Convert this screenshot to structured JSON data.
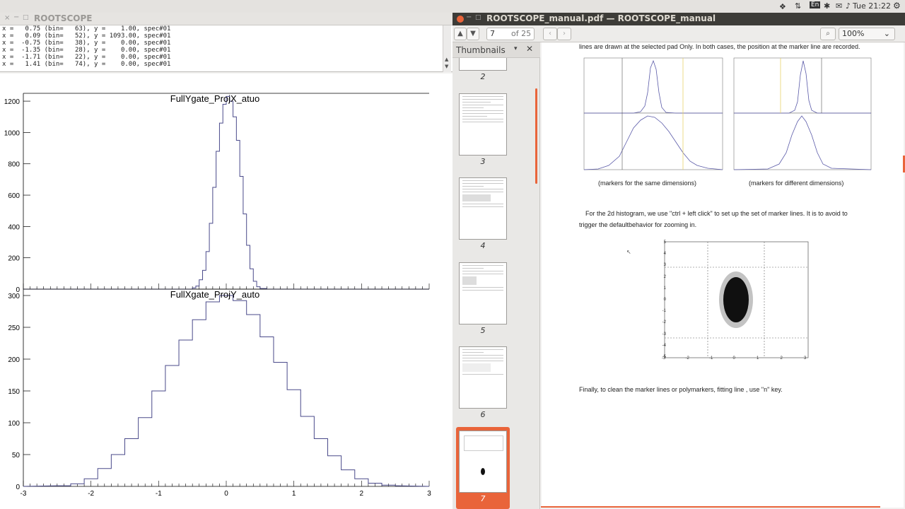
{
  "system": {
    "clock": "Tue 21:22",
    "keyboard": "En"
  },
  "root_window": {
    "title": "ROOTSCOPE",
    "console_lines": [
      "x =   0.75 (bin=   63), y =    1.00, spec#01",
      "x =   0.09 (bin=   52), y = 1093.00, spec#01",
      "x =  -0.75 (bin=   38), y =    0.00, spec#01",
      "x =  -1.35 (bin=   28), y =    0.00, spec#01",
      "x =  -1.71 (bin=   22), y =    0.00, spec#01",
      "x =   1.41 (bin=   74), y =    0.00, spec#01"
    ]
  },
  "pdf_window": {
    "title": "ROOTSCOPE_manual.pdf — ROOTSCOPE_manual",
    "page_current": "7",
    "page_total": "of 25",
    "zoom": "100%",
    "sidebar_mode": "Thumbnails",
    "thumbnails": [
      {
        "label": "2"
      },
      {
        "label": "3"
      },
      {
        "label": "4"
      },
      {
        "label": "5"
      },
      {
        "label": "6"
      },
      {
        "label": "7"
      }
    ],
    "page_text": {
      "line1": "lines are drawn at the selected pad Only. In both cases, the position at the marker line are recorded.",
      "caption_left": "(markers for the same dimensions)",
      "caption_right": "(markers for different dimensions)",
      "para2_line1": "For the 2d histogram, we use \"ctrl + left click\" to set up the set of marker lines. It is to avoid to",
      "para2_line2": "trigger the defaultbehavior for zooming in.",
      "para3": "Finally, to clean the marker lines or polymarkers, fitting line ,  use \"n\" key.",
      "scatter_yticks": [
        "5",
        "4",
        "3",
        "2",
        "1",
        "0",
        "-1",
        "-2",
        "-3",
        "-4",
        "-5"
      ],
      "scatter_xticks": [
        "-3",
        "-2",
        "-1",
        "0",
        "1",
        "2",
        "3"
      ]
    }
  },
  "chart_data": [
    {
      "type": "line",
      "title": "FullYgate_ProjX_atuo",
      "xlabel": "",
      "ylabel": "",
      "xlim": [
        -3,
        3
      ],
      "ylim": [
        0,
        1250
      ],
      "yticks": [
        0,
        200,
        400,
        600,
        800,
        1000,
        1200
      ],
      "x": [
        -0.6,
        -0.5,
        -0.45,
        -0.4,
        -0.35,
        -0.3,
        -0.25,
        -0.2,
        -0.15,
        -0.1,
        -0.05,
        0,
        0.05,
        0.1,
        0.15,
        0.2,
        0.25,
        0.3,
        0.35,
        0.4,
        0.45,
        0.5,
        0.6
      ],
      "values": [
        0,
        8,
        20,
        60,
        120,
        240,
        420,
        650,
        880,
        1060,
        1180,
        1230,
        1200,
        1100,
        950,
        720,
        480,
        280,
        130,
        50,
        15,
        4,
        0
      ]
    },
    {
      "type": "line",
      "title": "FullXgate_ProjY_auto",
      "xlabel": "",
      "ylabel": "",
      "xlim": [
        -3,
        3
      ],
      "ylim": [
        0,
        310
      ],
      "yticks": [
        0,
        50,
        100,
        150,
        200,
        250,
        300
      ],
      "xticks": [
        -3,
        -2,
        -1,
        0,
        1,
        2,
        3
      ],
      "x": [
        -2.5,
        -2.3,
        -2.1,
        -1.9,
        -1.7,
        -1.5,
        -1.3,
        -1.1,
        -0.9,
        -0.7,
        -0.5,
        -0.3,
        -0.1,
        0.1,
        0.3,
        0.5,
        0.7,
        0.9,
        1.1,
        1.3,
        1.5,
        1.7,
        1.9,
        2.1,
        2.3,
        2.5
      ],
      "values": [
        1,
        4,
        12,
        28,
        50,
        75,
        108,
        150,
        190,
        230,
        262,
        290,
        300,
        292,
        270,
        235,
        195,
        152,
        110,
        75,
        48,
        26,
        12,
        5,
        2,
        1
      ]
    }
  ]
}
